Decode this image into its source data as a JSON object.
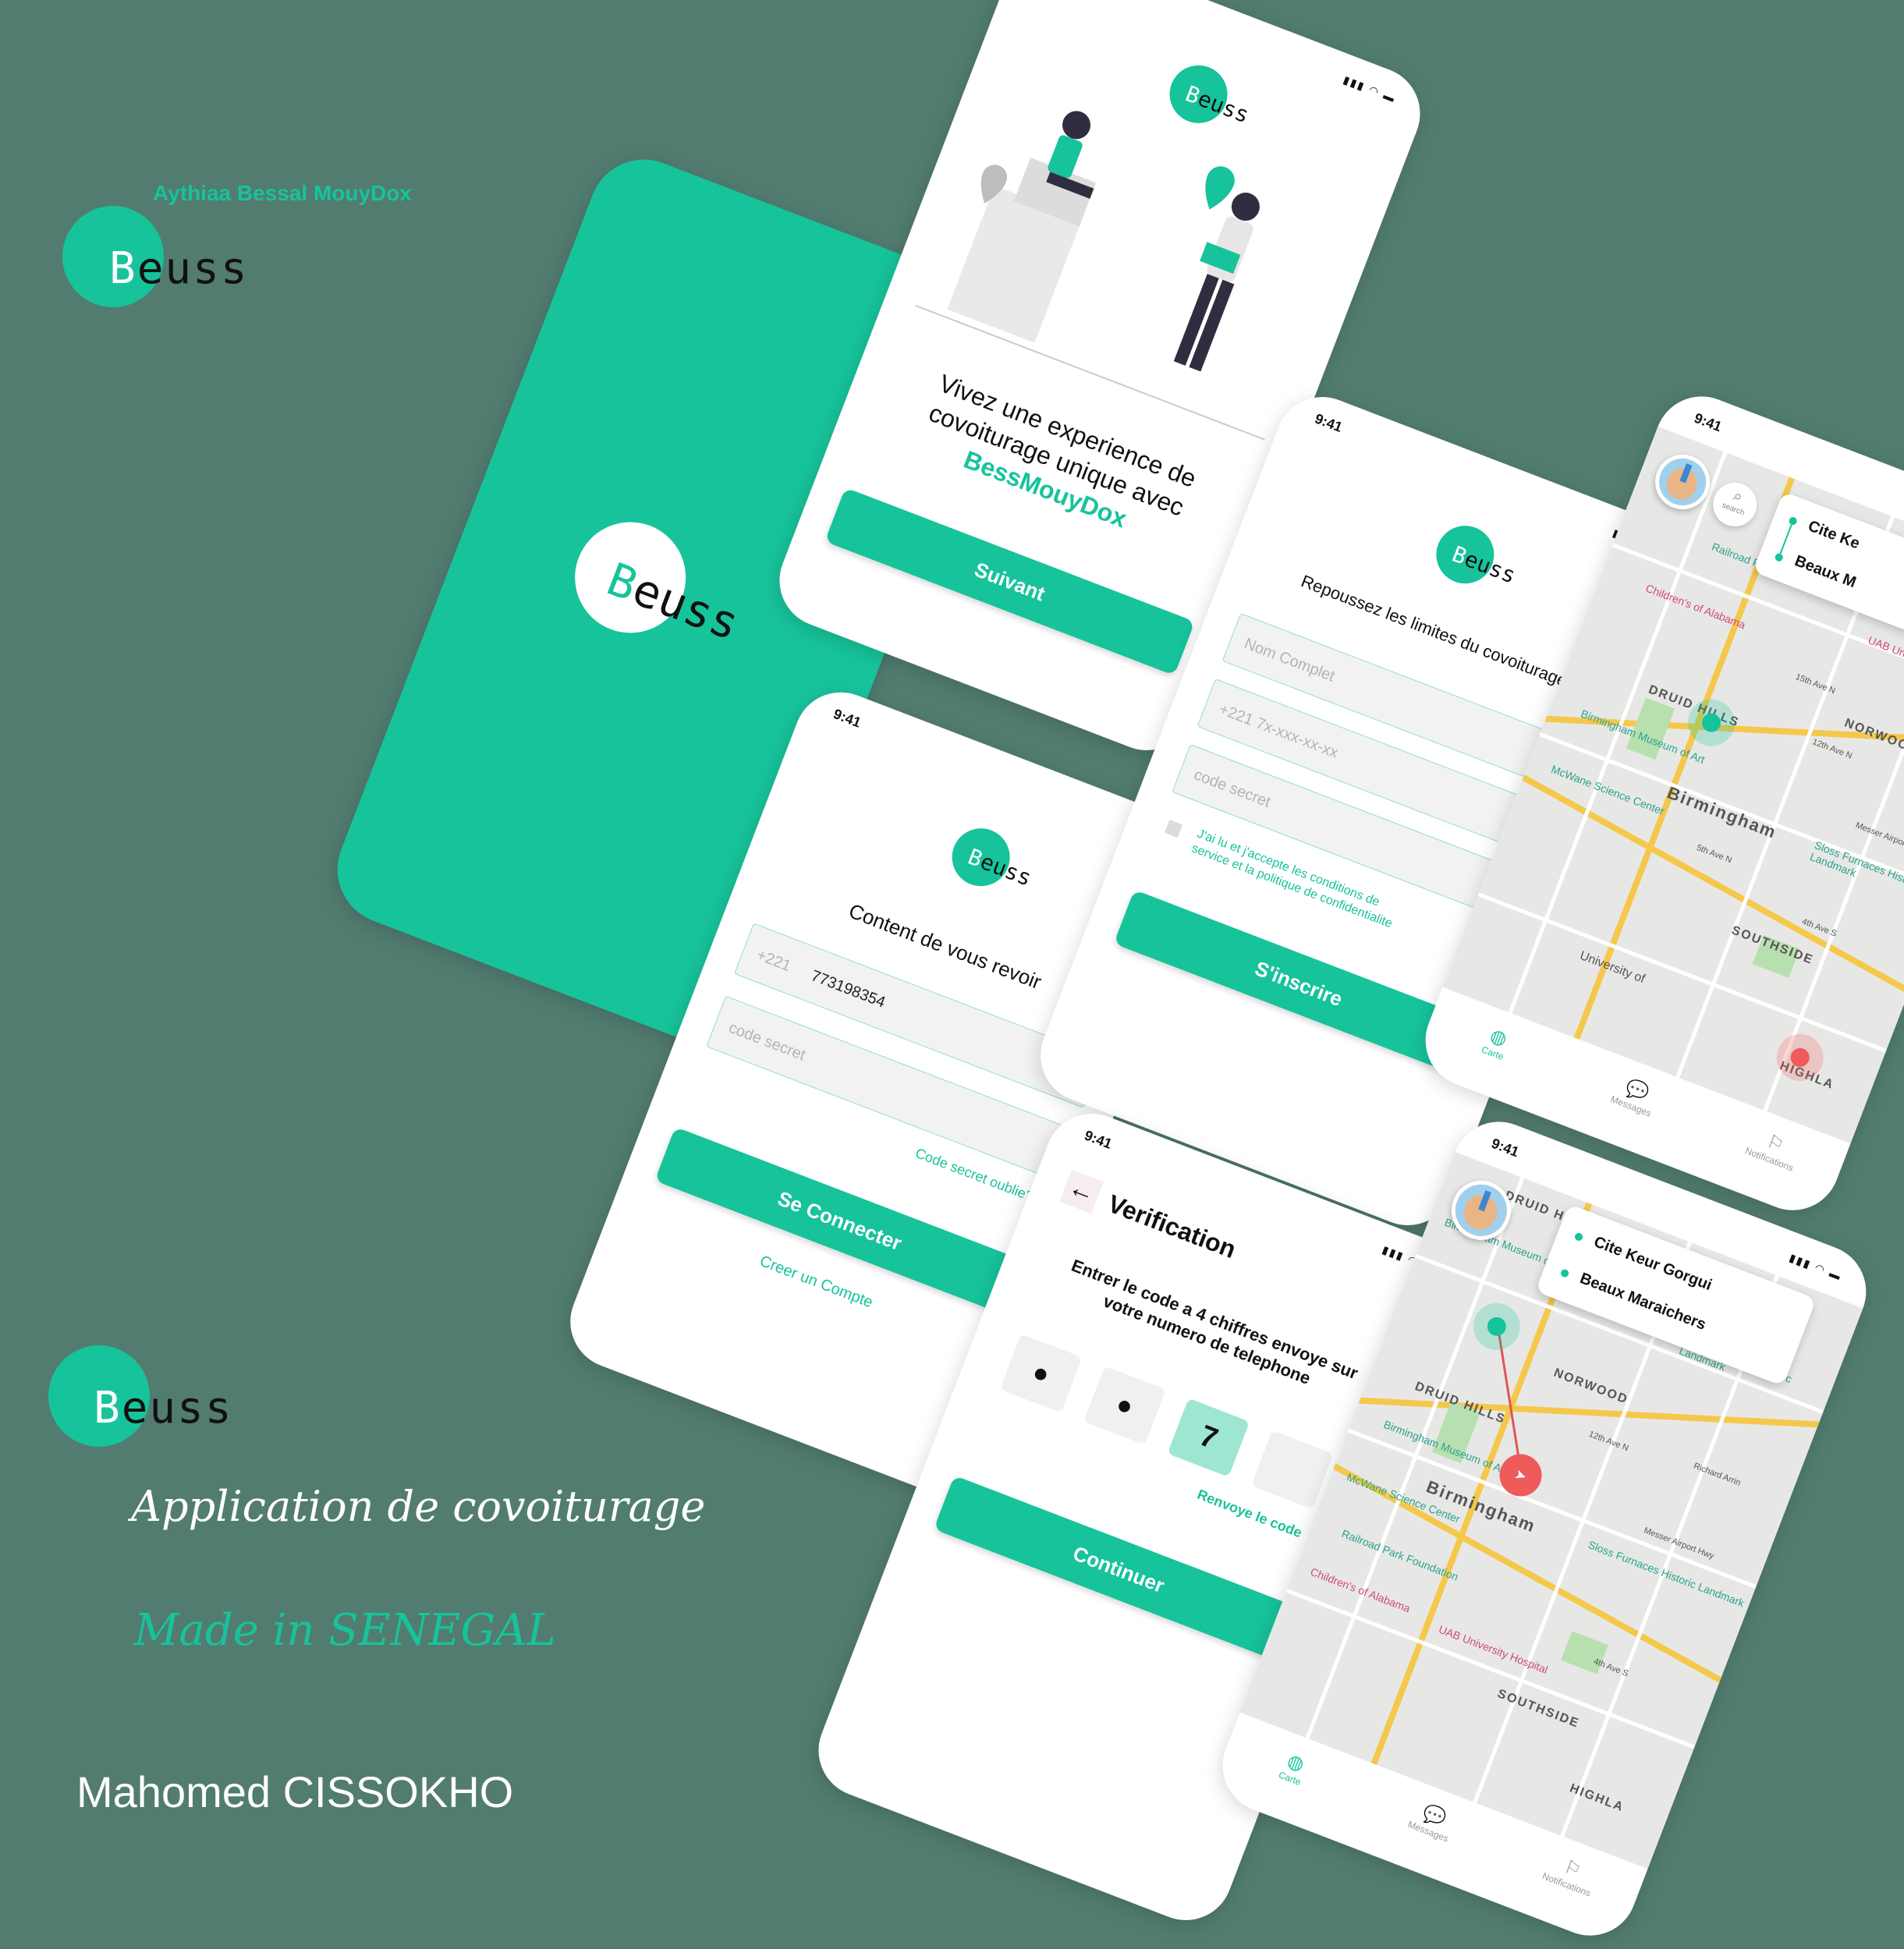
{
  "colors": {
    "background": "#527c70",
    "accent": "#17c39b",
    "white": "#ffffff",
    "red_pin": "#ef5a5a"
  },
  "branding": {
    "tagline_top": "Aythiaa Bessal MouyDox",
    "logo_b": "B",
    "logo_rest": "euss",
    "subtitle": "Application de covoiturage",
    "made_in": "Made in SENEGAL",
    "author": "Mahomed CISSOKHO"
  },
  "status": {
    "time": "9:41",
    "icons": "▮▮▮ ◠ ▬"
  },
  "splash": {
    "logo_b": "B",
    "logo_rest": "euss"
  },
  "onboarding": {
    "headline_1": "Vivez  une experience de",
    "headline_2": "covoiturage unique avec",
    "brand_name": "BessMouyDox",
    "next_button": "Suivant"
  },
  "login": {
    "greeting": "Content  de vous revoir",
    "phone_prefix": "+221",
    "phone_value": "773198354",
    "password_placeholder": "code  secret",
    "forgot_link": "Code secret oublie?",
    "login_button": "Se Connecter",
    "create_account_link": "Creer un Compte"
  },
  "signup": {
    "tagline": "Repoussez les limites du covoiturage",
    "name_placeholder": "Nom Complet",
    "phone_placeholder": "+221  7x-xxx-xx-xx",
    "password_placeholder": "code  secret",
    "terms_1": "J'ai  lu et j'accepte les conditions de",
    "terms_2": "service et la politique de confidentialite",
    "signup_button": "S'inscrire"
  },
  "verification": {
    "back": "←",
    "title": "Verification",
    "instructions_1": "Entrer  le code a  4 chiffres envoye sur",
    "instructions_2": "votre numero de telephone",
    "digits": [
      "●",
      "●",
      "7",
      ""
    ],
    "resend_link": "Renvoye le code",
    "continue_button": "Continuer"
  },
  "map_screen_1": {
    "search_label": "search",
    "route_from": "Cite Ke",
    "route_to": "Beaux M",
    "labels": [
      "Railroad Park Foundation",
      "Children's of Alabama",
      "UAB University Hospital",
      "NORWOOD",
      "DRUID HILLS",
      "Birmingham Museum of Art",
      "Birmingham",
      "McWane Science Center",
      "Sloss Furnaces Historic Landmark",
      "SOUTHSIDE",
      "University of",
      "HIGHLA",
      "15th Ave N",
      "12th Ave N",
      "5th Ave N",
      "4th Ave S",
      "Messer Airport Hwy"
    ],
    "tabs": [
      "Carte",
      "Messages",
      "Notifications"
    ]
  },
  "map_screen_2": {
    "route_from": "Cite Keur Gorgui",
    "route_to": "Beaux Maraichers",
    "labels": [
      "DRUID HILLS",
      "Birmingham Museum of Art",
      "Birmingham",
      "Sloss Furnaces Historic Landmark",
      "NORWOOD",
      "DRUID HILLS",
      "Birmingham Museum of Art",
      "Birmingham",
      "McWane Science Center",
      "Sloss Furnaces Historic Landmark",
      "Railroad Park Foundation",
      "Children's of Alabama",
      "UAB University Hospital",
      "SOUTHSIDE",
      "HIGHLA",
      "12th Ave N",
      "Richard Arrin",
      "Messer Airport Hwy",
      "4th Ave S"
    ],
    "tabs": [
      "Carte",
      "Messages",
      "Notifications"
    ]
  }
}
